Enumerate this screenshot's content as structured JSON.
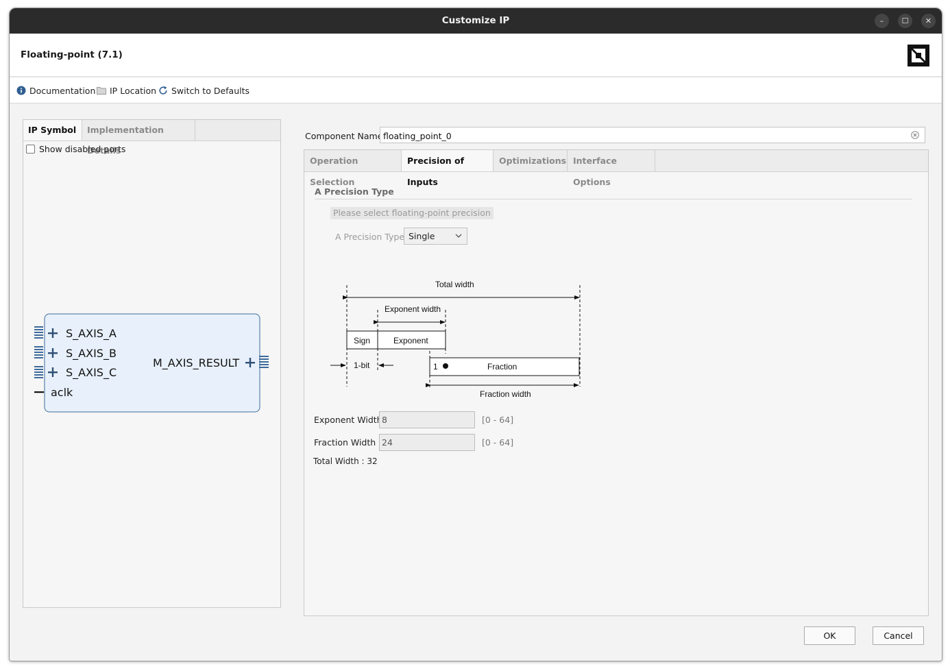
{
  "window": {
    "title": "Customize IP",
    "controls": {
      "minimize": "–",
      "maximize": "☐",
      "close": "✕"
    }
  },
  "header": {
    "title": "Floating-point (7.1)"
  },
  "toolbar": {
    "documentation": "Documentation",
    "ip_location": "IP Location",
    "switch_defaults": "Switch to Defaults"
  },
  "left_panel": {
    "tabs": [
      "IP Symbol",
      "Implementation Details"
    ],
    "show_disabled_ports": "Show disabled ports",
    "symbol": {
      "inputs": [
        "S_AXIS_A",
        "S_AXIS_B",
        "S_AXIS_C",
        "aclk"
      ],
      "output": "M_AXIS_RESULT",
      "block_fill": "#e8f1fb",
      "block_stroke": "#3c6a9a"
    }
  },
  "component": {
    "label": "Component Name",
    "value": "floating_point_0"
  },
  "right_panel": {
    "tabs": [
      "Operation Selection",
      "Precision of Inputs",
      "Optimizations",
      "Interface Options"
    ],
    "active_tab": "Precision of Inputs",
    "section_title": "A Precision Type",
    "hint": "Please select floating-point precision",
    "precision_type": {
      "label": "A Precision Type",
      "selected": "Single"
    },
    "diagram": {
      "total_width": "Total width",
      "exponent_width": "Exponent width",
      "sign": "Sign",
      "exponent": "Exponent",
      "one_bit": "1-bit",
      "one": "1",
      "fraction": "Fraction",
      "fraction_width": "Fraction width"
    },
    "exponent_width": {
      "label": "Exponent Width",
      "value": "8",
      "range": "[0 - 64]"
    },
    "fraction_width": {
      "label": "Fraction Width",
      "value": "24",
      "range": "[0 - 64]"
    },
    "total_width": "Total Width : 32"
  },
  "buttons": {
    "ok": "OK",
    "cancel": "Cancel"
  },
  "colors": {
    "titlebar": "#2b2b2b",
    "accent": "#3c6a9a",
    "panel": "#f6f6f6"
  }
}
